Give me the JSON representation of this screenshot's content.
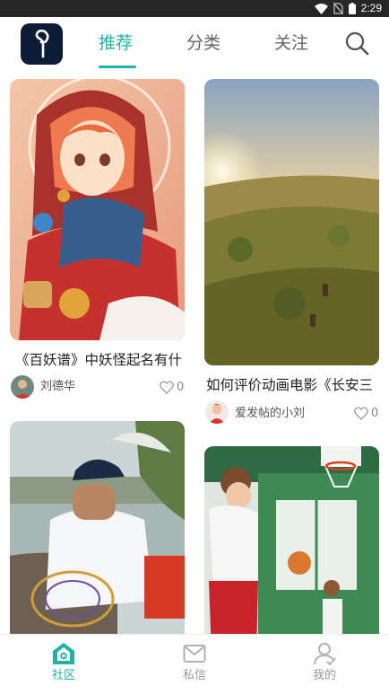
{
  "status_bar": {
    "time": "2:29",
    "icons": [
      "wifi-icon",
      "no-sim-icon",
      "battery-icon"
    ]
  },
  "header": {
    "logo": "app-logo",
    "tabs": [
      {
        "label": "推荐",
        "active": true
      },
      {
        "label": "分类",
        "active": false
      },
      {
        "label": "关注",
        "active": false
      }
    ],
    "search_icon": "search-icon"
  },
  "feed": {
    "cards": [
      {
        "title": "《百妖谱》中妖怪起名有什",
        "author": "刘德华",
        "likes": "0",
        "image": "anime-girl-hooded-cloak"
      },
      {
        "title": "如何评价动画电影《长安三",
        "author": "爱发帖的小刘",
        "likes": "0",
        "image": "sunset-grassland-horses"
      },
      {
        "title": "",
        "author": "",
        "likes": "",
        "image": "man-fishing-net"
      },
      {
        "title": "",
        "author": "",
        "likes": "",
        "image": "anime-basketball-gym"
      }
    ]
  },
  "bottom_nav": {
    "items": [
      {
        "label": "社区",
        "icon": "community-home-icon",
        "active": true
      },
      {
        "label": "私信",
        "icon": "mail-icon",
        "active": false
      },
      {
        "label": "我的",
        "icon": "profile-icon",
        "active": false
      }
    ]
  },
  "colors": {
    "accent": "#20b2a6",
    "status_bar": "#262626",
    "logo_bg": "#0d1c36"
  }
}
